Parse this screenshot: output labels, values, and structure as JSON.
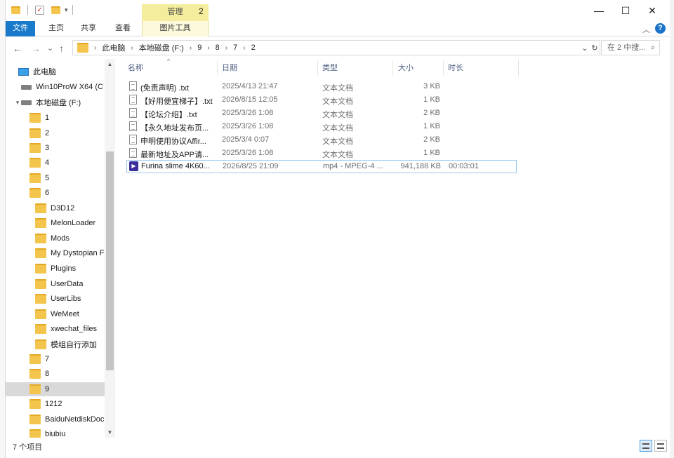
{
  "window": {
    "title": "2",
    "context_tab_header": "管理",
    "controls": {
      "minimize": "—",
      "maximize": "☐",
      "close": "✕"
    }
  },
  "ribbon": {
    "tabs": [
      {
        "label": "文件"
      },
      {
        "label": "主页"
      },
      {
        "label": "共享"
      },
      {
        "label": "查看"
      },
      {
        "label": "图片工具"
      }
    ],
    "collapse_glyph": "︿",
    "help_glyph": "?"
  },
  "nav": {
    "back": "←",
    "forward": "→",
    "recent": "⌄",
    "up": "↑",
    "breadcrumb": [
      "此电脑",
      "本地磁盘 (F:)",
      "9",
      "8",
      "7",
      "2"
    ],
    "address_dropdown": "⌄",
    "refresh": "↻",
    "search_placeholder": "在 2 中搜...",
    "search_glyph": "⌕"
  },
  "sidebar": {
    "items": [
      {
        "label": "此电脑",
        "icon": "pc-icon"
      },
      {
        "label": "Win10ProW X64 (C",
        "icon": "drive-icon"
      },
      {
        "label": "本地磁盘 (F:)",
        "icon": "drive-icon",
        "expanded": true
      },
      {
        "label": "1",
        "icon": "folder-icon"
      },
      {
        "label": "2",
        "icon": "folder-icon"
      },
      {
        "label": "3",
        "icon": "folder-icon"
      },
      {
        "label": "4",
        "icon": "folder-icon"
      },
      {
        "label": "5",
        "icon": "folder-icon"
      },
      {
        "label": "6",
        "icon": "folder-icon"
      },
      {
        "label": "D3D12",
        "icon": "folder-icon"
      },
      {
        "label": "MelonLoader",
        "icon": "folder-icon"
      },
      {
        "label": "Mods",
        "icon": "folder-icon"
      },
      {
        "label": "My Dystopian F",
        "icon": "folder-icon"
      },
      {
        "label": "Plugins",
        "icon": "folder-icon"
      },
      {
        "label": "UserData",
        "icon": "folder-icon"
      },
      {
        "label": "UserLibs",
        "icon": "folder-icon"
      },
      {
        "label": "WeMeet",
        "icon": "folder-icon"
      },
      {
        "label": "xwechat_files",
        "icon": "folder-icon"
      },
      {
        "label": "模组自行添加",
        "icon": "folder-icon"
      },
      {
        "label": "7",
        "icon": "folder-icon"
      },
      {
        "label": "8",
        "icon": "folder-icon"
      },
      {
        "label": "9",
        "icon": "folder-icon",
        "selected": true
      },
      {
        "label": "1212",
        "icon": "folder-icon"
      },
      {
        "label": "BaiduNetdiskDoc",
        "icon": "folder-icon"
      },
      {
        "label": "biubiu",
        "icon": "folder-icon"
      }
    ]
  },
  "columns": {
    "name": "名称",
    "date": "日期",
    "type": "类型",
    "size": "大小",
    "duration": "时长"
  },
  "files": [
    {
      "name": "(免责声明) .txt",
      "date": "2025/4/13 21:47",
      "type": "文本文档",
      "size": "3 KB",
      "duration": "",
      "icon": "text-file-icon"
    },
    {
      "name": "【好用便宜梯子】.txt",
      "date": "2026/8/15 12:05",
      "type": "文本文档",
      "size": "1 KB",
      "duration": "",
      "icon": "text-file-icon"
    },
    {
      "name": "【论坛介绍】.txt",
      "date": "2025/3/26 1:08",
      "type": "文本文档",
      "size": "2 KB",
      "duration": "",
      "icon": "text-file-icon"
    },
    {
      "name": "【永久地址发布页...",
      "date": "2025/3/26 1:08",
      "type": "文本文档",
      "size": "1 KB",
      "duration": "",
      "icon": "text-file-icon"
    },
    {
      "name": "申明使用协议Affir...",
      "date": "2025/3/4 0:07",
      "type": "文本文档",
      "size": "2 KB",
      "duration": "",
      "icon": "text-file-icon"
    },
    {
      "name": "最新地址及APP请...",
      "date": "2025/3/26 1:08",
      "type": "文本文档",
      "size": "1 KB",
      "duration": "",
      "icon": "text-file-icon"
    },
    {
      "name": "Furina slime 4K60...",
      "date": "2026/8/25 21:09",
      "type": "mp4 - MPEG-4 ...",
      "size": "941,188 KB",
      "duration": "00:03:01",
      "icon": "video-file-icon",
      "selected": true
    }
  ],
  "status": {
    "item_count": "7 个项目"
  }
}
